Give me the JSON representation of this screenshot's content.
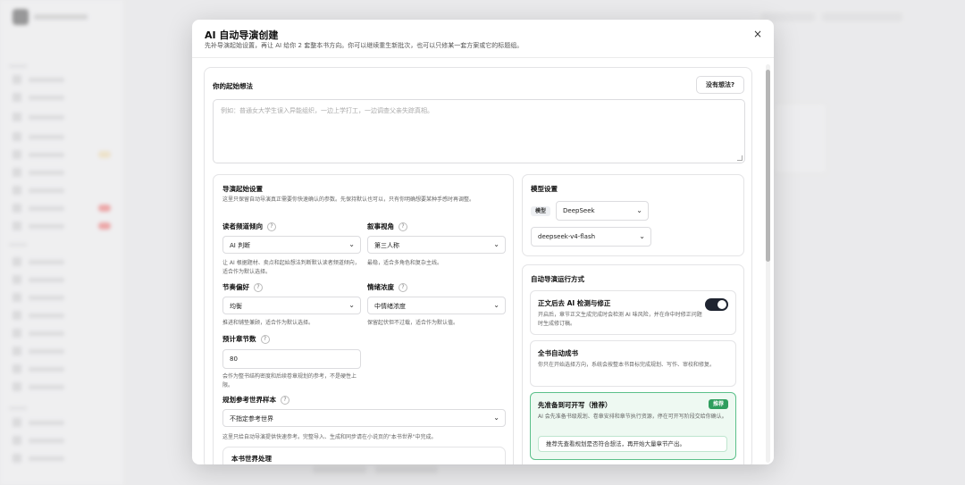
{
  "modal": {
    "title": "AI 自动导演创建",
    "subtitle": "先补导演起始设置，再让 AI 给你 2 套整本书方向。你可以继续重生新批次，也可以只修某一套方案或它的标题组。",
    "close_glyph": "×"
  },
  "idea": {
    "label": "你的起始想法",
    "no_idea_button": "没有想法?",
    "placeholder": "例如：普通女大学生误入异能组织，一边上学打工，一边调查父亲失踪真相。"
  },
  "director": {
    "heading": "导演起始设置",
    "description": "这里只保留自动导演真正需要你快速确认的参数。先保持默认也可以，只有你明确想要某种手感时再调整。",
    "reader_channel": {
      "label": "读者频道倾向",
      "value": "AI 判断",
      "note": "让 AI 根据题材、卖点和起始想法判断默认读者频道倾向，适合作为默认选择。"
    },
    "pov": {
      "label": "叙事视角",
      "value": "第三人称",
      "note": "最稳，适合多角色和复杂主线。"
    },
    "pace": {
      "label": "节奏偏好",
      "value": "均衡",
      "note": "推进和铺垫兼顾，适合作为默认选择。"
    },
    "emotion": {
      "label": "情绪浓度",
      "value": "中情绪浓度",
      "note": "保留起伏但不过载，适合作为默认值。"
    },
    "chapters": {
      "label": "预计章节数",
      "value": "80",
      "note": "会作为整书结构密度和后续卷章规划的参考，不是硬性上限。"
    },
    "world_sample": {
      "label": "规划参考世界样本",
      "value": "不指定参考世界",
      "note": "这里只给自动导演提供快速参考。完整导入、生成和同步请在小说页的\"本书世界\"中完成。"
    },
    "book_world": {
      "label": "本书世界处理"
    }
  },
  "model": {
    "heading": "模型设置",
    "tag": "模型",
    "provider": "DeepSeek",
    "model_name": "deepseek-v4-flash"
  },
  "run_mode": {
    "heading": "自动导演运行方式",
    "options": [
      {
        "title": "正文后去 AI 检测与修正",
        "desc": "开启后，章节正文生成完成时会检测 AI 味风险，并在命中时修正问题时生成修订稿。"
      },
      {
        "title": "全书自动成书",
        "desc": "你只在开始选择方向，系统会按整本书目标完成规划、写作、审校和修复。"
      },
      {
        "title": "先准备到可开写（推荐）",
        "badge": "推荐",
        "desc": "AI 会先准备书级规划、卷章安排和章节执行资源，停在可开写阶段交给你确认。",
        "hint": "推荐先查看规划是否符合想法，再开始大量章节产出。"
      }
    ]
  },
  "icons": {
    "chevron": "⌄",
    "help": "?"
  },
  "colors": {
    "accent_green": "#2f9e5e",
    "toggle_dark": "#1f2430"
  }
}
